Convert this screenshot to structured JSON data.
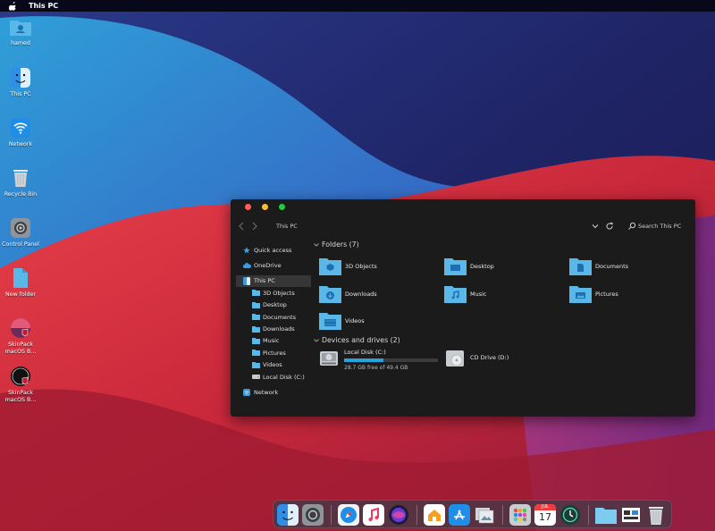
{
  "menubar": {
    "app_name": "This PC"
  },
  "desktop_icons": [
    {
      "label": "hamed",
      "icon": "user-folder-icon"
    },
    {
      "label": "This PC",
      "icon": "finder-icon"
    },
    {
      "label": "Network",
      "icon": "wifi-icon"
    },
    {
      "label": "Recycle Bin",
      "icon": "trash-icon"
    },
    {
      "label": "Control Panel",
      "icon": "settings-icon"
    },
    {
      "label": "New folder",
      "icon": "folder-icon"
    },
    {
      "label": "SkinPack\nmacOS B...",
      "icon": "skinpack-icon"
    },
    {
      "label": "SkinPack\nmacOS B...",
      "icon": "skinpack-icon"
    }
  ],
  "window": {
    "address": "This PC",
    "search_placeholder": "Search This PC",
    "sidebar": [
      {
        "label": "Quick access",
        "icon": "star-icon",
        "level": 0
      },
      {
        "label": "OneDrive",
        "icon": "cloud-icon",
        "level": 0
      },
      {
        "label": "This PC",
        "icon": "computer-icon",
        "level": 0,
        "selected": true
      },
      {
        "label": "3D Objects",
        "icon": "folder-icon",
        "level": 1
      },
      {
        "label": "Desktop",
        "icon": "folder-icon",
        "level": 1
      },
      {
        "label": "Documents",
        "icon": "folder-icon",
        "level": 1
      },
      {
        "label": "Downloads",
        "icon": "folder-icon",
        "level": 1
      },
      {
        "label": "Music",
        "icon": "folder-icon",
        "level": 1
      },
      {
        "label": "Pictures",
        "icon": "folder-icon",
        "level": 1
      },
      {
        "label": "Videos",
        "icon": "folder-icon",
        "level": 1
      },
      {
        "label": "Local Disk (C:)",
        "icon": "drive-icon",
        "level": 1
      },
      {
        "label": "Network",
        "icon": "network-icon",
        "level": 0
      }
    ],
    "folders_header": "Folders (7)",
    "folders": [
      {
        "label": "3D Objects",
        "icon": "3d-objects-folder-icon"
      },
      {
        "label": "Desktop",
        "icon": "desktop-folder-icon"
      },
      {
        "label": "Documents",
        "icon": "documents-folder-icon"
      },
      {
        "label": "Downloads",
        "icon": "downloads-folder-icon"
      },
      {
        "label": "Music",
        "icon": "music-folder-icon"
      },
      {
        "label": "Pictures",
        "icon": "pictures-folder-icon"
      },
      {
        "label": "Videos",
        "icon": "videos-folder-icon"
      }
    ],
    "drives_header": "Devices and drives (2)",
    "drives": [
      {
        "label": "Local Disk (C:)",
        "free_text": "28.7 GB free of 49.4 GB",
        "used_fraction": 0.42,
        "icon": "hard-disk-icon"
      },
      {
        "label": "CD Drive (D:)",
        "icon": "cd-drive-icon"
      }
    ]
  },
  "dock": [
    "finder-icon",
    "settings-icon",
    "safari-icon",
    "music-icon",
    "siri-icon",
    "home-icon",
    "app-store-icon",
    "preview-icon",
    "launchpad-icon",
    "calendar-icon",
    "time-machine-icon",
    "folder-icon",
    "screenshot-icon",
    "trash-icon"
  ],
  "calendar": {
    "month": "JUL",
    "day": "17"
  },
  "colors": {
    "accent": "#27a4dc",
    "folder": "#5ab8e8",
    "window_bg": "#1b1b1b"
  }
}
